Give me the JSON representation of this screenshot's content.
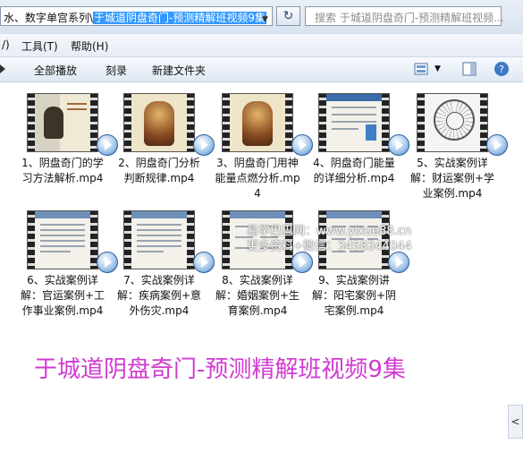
{
  "address": {
    "path_prefix": "水、数字单宫系列\\",
    "path_selected": "于城道阴盘奇门-预测精解班视频9集",
    "dropdown_glyph": "▼",
    "refresh_glyph": "↻"
  },
  "search": {
    "placeholder": "搜索 于城道阴盘奇门-预测精解班视频..."
  },
  "menu": {
    "items": [
      "/)",
      "工具(T)",
      "帮助(H)"
    ]
  },
  "toolbar": {
    "play_all": "全部播放",
    "burn": "刻录",
    "new_folder": "新建文件夹",
    "view_dropdown_glyph": "▼"
  },
  "files": [
    {
      "name": "1、阴盘奇门的学习方法解析.mp4"
    },
    {
      "name": "2、阴盘奇门分析判断规律.mp4"
    },
    {
      "name": "3、阴盘奇门用神能量点燃分析.mp4"
    },
    {
      "name": "4、阴盘奇门能量的详细分析.mp4"
    },
    {
      "name": "5、实战案例详解：财运案例+学业案例.mp4"
    },
    {
      "name": "6、实战案例详解：官运案例+工作事业案例.mp4"
    },
    {
      "name": "7、实战案例详解：疾病案例+意外伤灾.mp4"
    },
    {
      "name": "8、实战案例详解：婚姻案例+生育案例.mp4"
    },
    {
      "name": "9、实战案例讲解：阳宅案例+阴宅案例.mp4"
    }
  ],
  "watermark": {
    "line1": "易学巴巴网：www.yixue88.cn",
    "line2": "更多资料+微信：3458344044"
  },
  "banner_title": "于城道阴盘奇门-预测精解班视频9集",
  "side_tab_glyph": "<"
}
